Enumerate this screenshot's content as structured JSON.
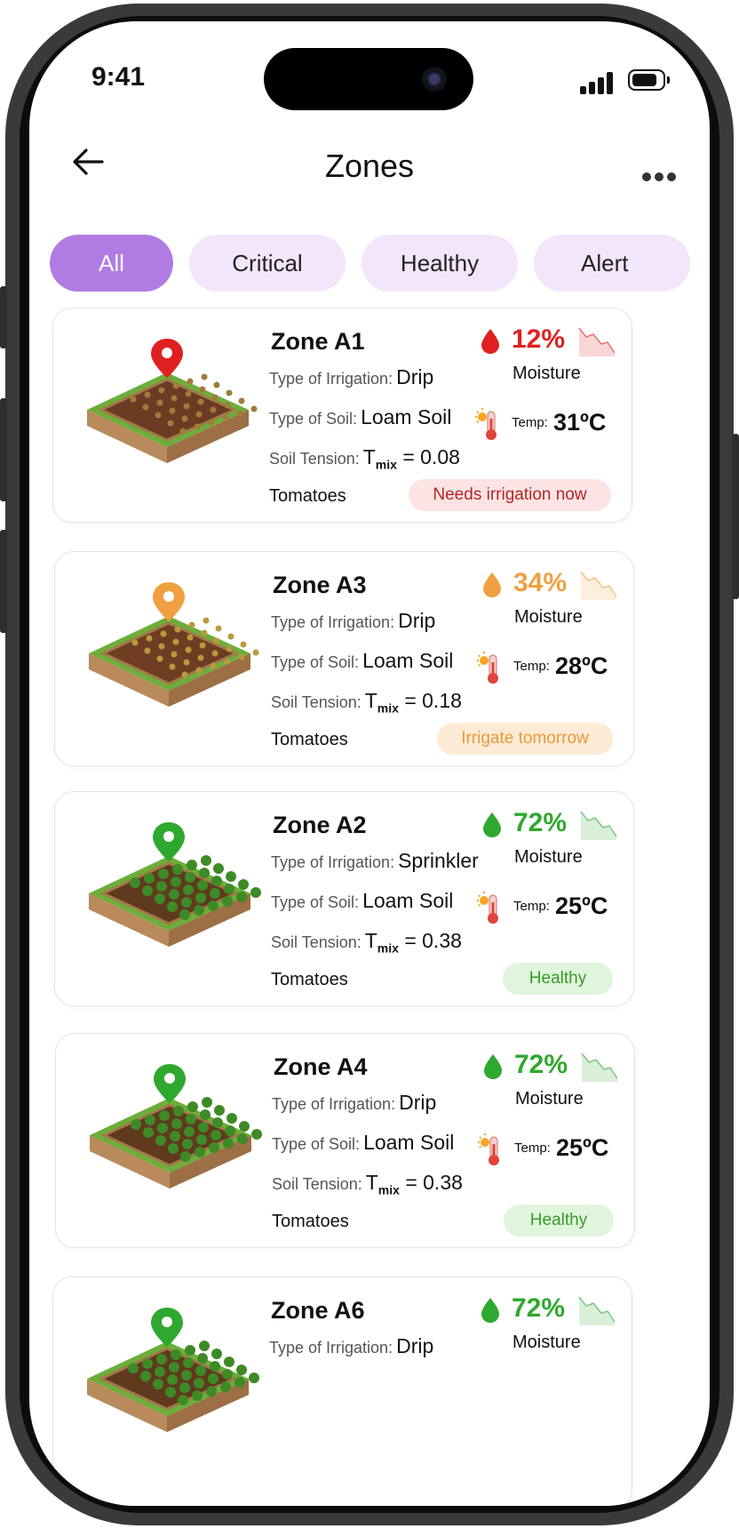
{
  "status_bar": {
    "time": "9:41"
  },
  "header": {
    "title": "Zones"
  },
  "filters": [
    {
      "label": "All",
      "active": true
    },
    {
      "label": "Critical",
      "active": false
    },
    {
      "label": "Healthy",
      "active": false
    },
    {
      "label": "Alert",
      "active": false
    }
  ],
  "labels": {
    "irrigation": "Type of Irrigation:",
    "soil": "Type of Soil:",
    "tension": "Soil Tension:",
    "tmix_symbol": "T",
    "tmix_sub": "mix",
    "moisture": "Moisture",
    "temp": "Temp:"
  },
  "colors": {
    "critical": "#e02020",
    "warning": "#f0a040",
    "healthy": "#2fa82f",
    "accent": "#b07ce3"
  },
  "zones": [
    {
      "name": "Zone A1",
      "irrigation": "Drip",
      "soil": "Loam Soil",
      "tension": "= 0.08",
      "crop": "Tomatoes",
      "moisture": "12%",
      "temp": "31ºC",
      "status": "Needs irrigation now",
      "level": "critical",
      "pin_icon": "red-map-pin-icon",
      "art": "dry-soil-plot"
    },
    {
      "name": "Zone A3",
      "irrigation": "Drip",
      "soil": "Loam Soil",
      "tension": "= 0.18",
      "crop": "Tomatoes",
      "moisture": "34%",
      "temp": "28ºC",
      "status": "Irrigate tomorrow",
      "level": "warning",
      "pin_icon": "orange-map-pin-icon",
      "art": "sprouting-soil-plot"
    },
    {
      "name": "Zone A2",
      "irrigation": "Sprinkler",
      "soil": "Loam Soil",
      "tension": "= 0.38",
      "crop": "Tomatoes",
      "moisture": "72%",
      "temp": "25ºC",
      "status": "Healthy",
      "level": "healthy",
      "pin_icon": "green-map-pin-icon",
      "art": "green-crop-plot"
    },
    {
      "name": "Zone A4",
      "irrigation": "Drip",
      "soil": "Loam Soil",
      "tension": "= 0.38",
      "crop": "Tomatoes",
      "moisture": "72%",
      "temp": "25ºC",
      "status": "Healthy",
      "level": "healthy",
      "pin_icon": "green-map-pin-icon",
      "art": "green-crop-plot"
    },
    {
      "name": "Zone A6",
      "irrigation": "Drip",
      "moisture": "72%",
      "level": "healthy",
      "pin_icon": "green-map-pin-icon",
      "art": "green-crop-plot"
    }
  ]
}
